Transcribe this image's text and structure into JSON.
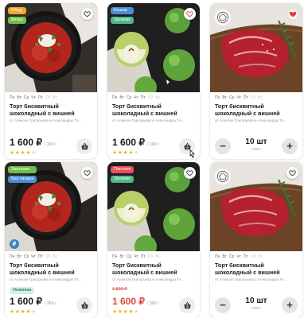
{
  "colors": {
    "green_badge": "#6cbf4a",
    "blue_badge": "#4a8fd6",
    "orange_badge": "#f0a92c",
    "red_badge": "#e8505b",
    "teal_badge": "#4fb889",
    "star": "#f3b61f",
    "heart_red": "#e5393f"
  },
  "days": [
    "Пн",
    "Вт",
    "Ср",
    "Чт",
    "Пт",
    "Сб",
    "Вс"
  ],
  "cards": [
    {
      "badges": [
        "Обед",
        "Веган"
      ],
      "image": "borscht-bowl",
      "favorite": false,
      "title": "Торт бисквитный шоколадный с вишней",
      "subtitle": "от Алексея Григорьева и Александры Те...",
      "price": "1 600 ₽",
      "unit": "/ 360 г",
      "rating": 4,
      "action": "cart"
    },
    {
      "badges": [
        "Кошер",
        "Органик"
      ],
      "image": "green-apples",
      "favorite": false,
      "title": "Торт бисквитный шоколадный с вишней",
      "subtitle": "от Алексея Григорьева и Александры Те...",
      "price": "1 600 ₽",
      "unit": "/ 360 г",
      "rating": 4,
      "action": "cart"
    },
    {
      "badges": [],
      "image": "raw-steak",
      "favorite": true,
      "title": "Торт бисквитный шоколадный с вишней",
      "subtitle": "от Алексея Григорьева и Александры Те...",
      "quantity": "10 шт",
      "quantity_sub": "/ 600 г",
      "action": "stepper"
    },
    {
      "badges": [
        "Завтраки",
        "Без сахара"
      ],
      "image": "borscht-bowl",
      "favorite": false,
      "title": "Торт бисквитный шоколадный с вишней",
      "subtitle": "от Алексея Григорьева и Александры Те...",
      "tag": "Новинка",
      "price": "1 600 ₽",
      "unit": "/ 360 г",
      "rating": 4,
      "action": "cart"
    },
    {
      "badges": [
        "Постное",
        "Органик"
      ],
      "image": "green-apples",
      "favorite": false,
      "title": "Торт бисквитный шоколадный с вишней",
      "subtitle": "от Алексея Григорьева и Александры Те...",
      "old_price": "1 800 ₽",
      "price": "1 600 ₽",
      "unit": "/ 360 г",
      "rating": 4,
      "action": "cart"
    },
    {
      "badges": [],
      "image": "raw-steak",
      "favorite": false,
      "title": "Торт бисквитный шоколадный с вишней",
      "subtitle": "от Алексея Григорьева и Александры Те...",
      "quantity": "10 шт",
      "quantity_sub": "/ 600 г",
      "action": "stepper"
    }
  ]
}
